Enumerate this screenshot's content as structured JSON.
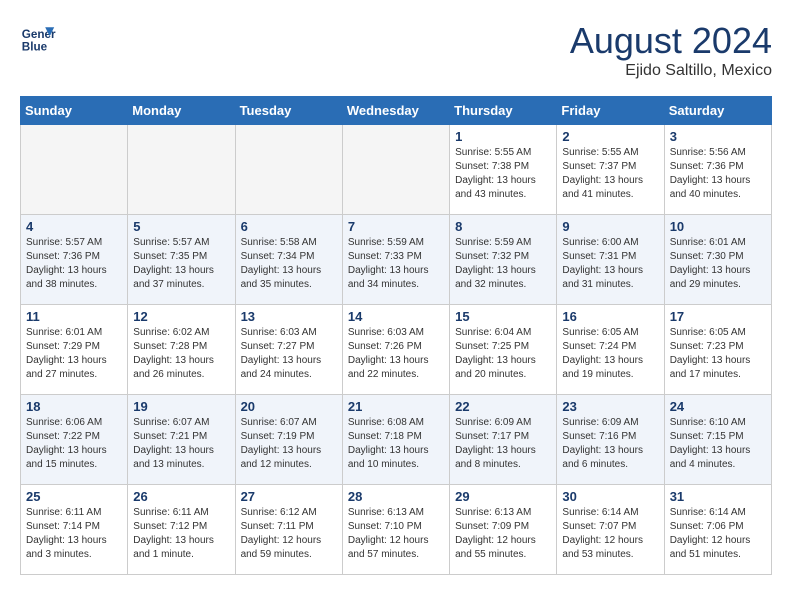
{
  "header": {
    "logo_line1": "General",
    "logo_line2": "Blue",
    "month": "August 2024",
    "location": "Ejido Saltillo, Mexico"
  },
  "weekdays": [
    "Sunday",
    "Monday",
    "Tuesday",
    "Wednesday",
    "Thursday",
    "Friday",
    "Saturday"
  ],
  "weeks": [
    [
      {
        "day": "",
        "info": ""
      },
      {
        "day": "",
        "info": ""
      },
      {
        "day": "",
        "info": ""
      },
      {
        "day": "",
        "info": ""
      },
      {
        "day": "1",
        "info": "Sunrise: 5:55 AM\nSunset: 7:38 PM\nDaylight: 13 hours\nand 43 minutes."
      },
      {
        "day": "2",
        "info": "Sunrise: 5:55 AM\nSunset: 7:37 PM\nDaylight: 13 hours\nand 41 minutes."
      },
      {
        "day": "3",
        "info": "Sunrise: 5:56 AM\nSunset: 7:36 PM\nDaylight: 13 hours\nand 40 minutes."
      }
    ],
    [
      {
        "day": "4",
        "info": "Sunrise: 5:57 AM\nSunset: 7:36 PM\nDaylight: 13 hours\nand 38 minutes."
      },
      {
        "day": "5",
        "info": "Sunrise: 5:57 AM\nSunset: 7:35 PM\nDaylight: 13 hours\nand 37 minutes."
      },
      {
        "day": "6",
        "info": "Sunrise: 5:58 AM\nSunset: 7:34 PM\nDaylight: 13 hours\nand 35 minutes."
      },
      {
        "day": "7",
        "info": "Sunrise: 5:59 AM\nSunset: 7:33 PM\nDaylight: 13 hours\nand 34 minutes."
      },
      {
        "day": "8",
        "info": "Sunrise: 5:59 AM\nSunset: 7:32 PM\nDaylight: 13 hours\nand 32 minutes."
      },
      {
        "day": "9",
        "info": "Sunrise: 6:00 AM\nSunset: 7:31 PM\nDaylight: 13 hours\nand 31 minutes."
      },
      {
        "day": "10",
        "info": "Sunrise: 6:01 AM\nSunset: 7:30 PM\nDaylight: 13 hours\nand 29 minutes."
      }
    ],
    [
      {
        "day": "11",
        "info": "Sunrise: 6:01 AM\nSunset: 7:29 PM\nDaylight: 13 hours\nand 27 minutes."
      },
      {
        "day": "12",
        "info": "Sunrise: 6:02 AM\nSunset: 7:28 PM\nDaylight: 13 hours\nand 26 minutes."
      },
      {
        "day": "13",
        "info": "Sunrise: 6:03 AM\nSunset: 7:27 PM\nDaylight: 13 hours\nand 24 minutes."
      },
      {
        "day": "14",
        "info": "Sunrise: 6:03 AM\nSunset: 7:26 PM\nDaylight: 13 hours\nand 22 minutes."
      },
      {
        "day": "15",
        "info": "Sunrise: 6:04 AM\nSunset: 7:25 PM\nDaylight: 13 hours\nand 20 minutes."
      },
      {
        "day": "16",
        "info": "Sunrise: 6:05 AM\nSunset: 7:24 PM\nDaylight: 13 hours\nand 19 minutes."
      },
      {
        "day": "17",
        "info": "Sunrise: 6:05 AM\nSunset: 7:23 PM\nDaylight: 13 hours\nand 17 minutes."
      }
    ],
    [
      {
        "day": "18",
        "info": "Sunrise: 6:06 AM\nSunset: 7:22 PM\nDaylight: 13 hours\nand 15 minutes."
      },
      {
        "day": "19",
        "info": "Sunrise: 6:07 AM\nSunset: 7:21 PM\nDaylight: 13 hours\nand 13 minutes."
      },
      {
        "day": "20",
        "info": "Sunrise: 6:07 AM\nSunset: 7:19 PM\nDaylight: 13 hours\nand 12 minutes."
      },
      {
        "day": "21",
        "info": "Sunrise: 6:08 AM\nSunset: 7:18 PM\nDaylight: 13 hours\nand 10 minutes."
      },
      {
        "day": "22",
        "info": "Sunrise: 6:09 AM\nSunset: 7:17 PM\nDaylight: 13 hours\nand 8 minutes."
      },
      {
        "day": "23",
        "info": "Sunrise: 6:09 AM\nSunset: 7:16 PM\nDaylight: 13 hours\nand 6 minutes."
      },
      {
        "day": "24",
        "info": "Sunrise: 6:10 AM\nSunset: 7:15 PM\nDaylight: 13 hours\nand 4 minutes."
      }
    ],
    [
      {
        "day": "25",
        "info": "Sunrise: 6:11 AM\nSunset: 7:14 PM\nDaylight: 13 hours\nand 3 minutes."
      },
      {
        "day": "26",
        "info": "Sunrise: 6:11 AM\nSunset: 7:12 PM\nDaylight: 13 hours\nand 1 minute."
      },
      {
        "day": "27",
        "info": "Sunrise: 6:12 AM\nSunset: 7:11 PM\nDaylight: 12 hours\nand 59 minutes."
      },
      {
        "day": "28",
        "info": "Sunrise: 6:13 AM\nSunset: 7:10 PM\nDaylight: 12 hours\nand 57 minutes."
      },
      {
        "day": "29",
        "info": "Sunrise: 6:13 AM\nSunset: 7:09 PM\nDaylight: 12 hours\nand 55 minutes."
      },
      {
        "day": "30",
        "info": "Sunrise: 6:14 AM\nSunset: 7:07 PM\nDaylight: 12 hours\nand 53 minutes."
      },
      {
        "day": "31",
        "info": "Sunrise: 6:14 AM\nSunset: 7:06 PM\nDaylight: 12 hours\nand 51 minutes."
      }
    ]
  ]
}
